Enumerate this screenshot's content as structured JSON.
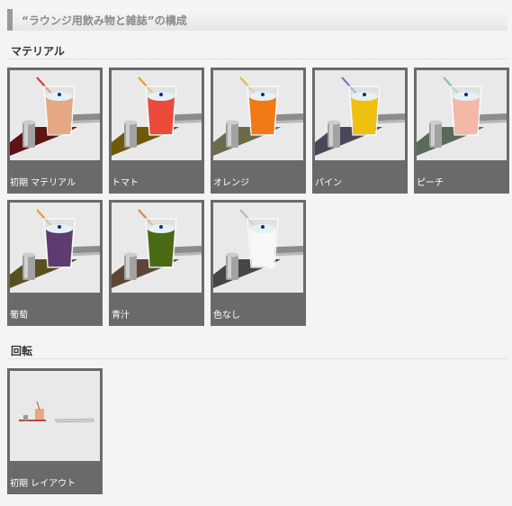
{
  "title": "“ラウンジ用飲み物と雑誌”の構成",
  "sections": [
    {
      "heading": "マテリアル",
      "items": [
        {
          "label": "初期 マテリアル",
          "liquid": "#e6a884",
          "straw": "#c9443a",
          "base": "#5c1414"
        },
        {
          "label": "トマト",
          "liquid": "#ec4b3c",
          "straw": "#e0a032",
          "base": "#6f5a0a"
        },
        {
          "label": "オレンジ",
          "liquid": "#f27a14",
          "straw": "#e1b94a",
          "base": "#6b6b4a"
        },
        {
          "label": "パイン",
          "liquid": "#f0c00e",
          "straw": "#8a6ec8",
          "base": "#4a4858"
        },
        {
          "label": "ピーチ",
          "liquid": "#f3b8a6",
          "straw": "#7ec6a2",
          "base": "#5a6a5a"
        },
        {
          "label": "葡萄",
          "liquid": "#5e3b70",
          "straw": "#e0a032",
          "base": "#5a5020"
        },
        {
          "label": "青汁",
          "liquid": "#4a6a14",
          "straw": "#e0843a",
          "base": "#5e4636"
        },
        {
          "label": "色なし",
          "liquid": "#f8f8f8",
          "straw": "#bbbbbb",
          "base": "#464646"
        }
      ]
    },
    {
      "heading": "回転",
      "items": [
        {
          "label": "初期 レイアウト",
          "liquid": "#e6a884",
          "straw": "#c9443a",
          "base": "#b54a3a"
        }
      ]
    }
  ]
}
